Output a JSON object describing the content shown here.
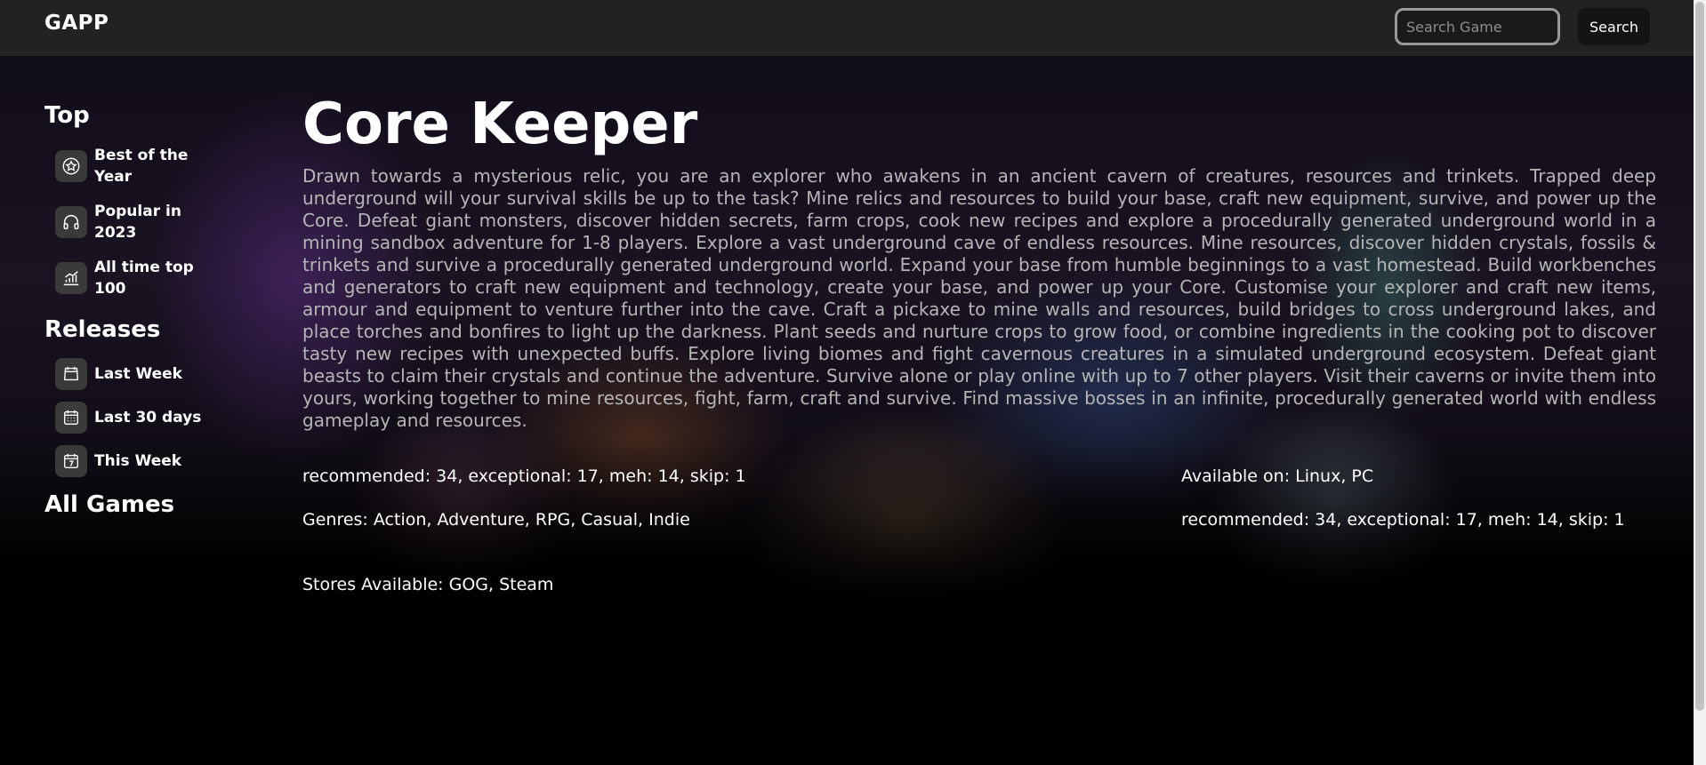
{
  "header": {
    "logo": "GAPP",
    "search_placeholder": "Search Game",
    "search_button": "Search"
  },
  "sidebar": {
    "top_heading": "Top",
    "top_items": [
      {
        "label": "Best of the Year",
        "icon": "star-icon"
      },
      {
        "label": "Popular in 2023",
        "icon": "headphones-icon"
      },
      {
        "label": "All time top 100",
        "icon": "chart-icon"
      }
    ],
    "releases_heading": "Releases",
    "release_items": [
      {
        "label": "Last Week",
        "icon": "calendar-week-icon"
      },
      {
        "label": "Last 30 days",
        "icon": "calendar-month-icon"
      },
      {
        "label": "This Week",
        "icon": "calendar-day-icon"
      }
    ],
    "all_games_heading": "All Games"
  },
  "game": {
    "title": "Core Keeper",
    "description": "Drawn towards a mysterious relic, you are an explorer who awakens in an ancient cavern of creatures, resources and trinkets. Trapped deep underground will your survival skills be up to the task? Mine relics and resources to build your base, craft new equipment, survive, and power up the Core. Defeat giant monsters, discover hidden secrets, farm crops, cook new recipes and explore a procedurally generated underground world in a mining sandbox adventure for 1-8 players. Explore a vast underground cave of endless resources. Mine resources, discover hidden crystals, fossils & trinkets and survive a procedurally generated underground world. Expand your base from humble beginnings to a vast homestead. Build workbenches and generators to craft new equipment and technology, create your base, and power up your Core. Customise your explorer and craft new items, armour and equipment to venture further into the cave. Craft a pickaxe to mine walls and resources, build bridges to cross underground lakes, and place torches and bonfires to light up the darkness. Plant seeds and nurture crops to grow food, or combine ingredients in the cooking pot to discover tasty new recipes with unexpected buffs. Explore living biomes and fight cavernous creatures in a simulated underground ecosystem. Defeat giant beasts to claim their crystals and continue the adventure. Survive alone or play online with up to 7 other players. Visit their caverns or invite them into yours, working together to mine resources, fight, farm, craft and survive. Find massive bosses in an infinite, procedurally generated world with endless gameplay and resources.",
    "ratings": "recommended: 34, exceptional: 17, meh: 14, skip: 1",
    "genres": "Genres: Action, Adventure, RPG, Casual, Indie",
    "stores": "Stores Available: GOG, Steam",
    "platforms": "Available on: Linux, PC",
    "ratings_repeat": "recommended: 34, exceptional: 17, meh: 14, skip: 1"
  }
}
